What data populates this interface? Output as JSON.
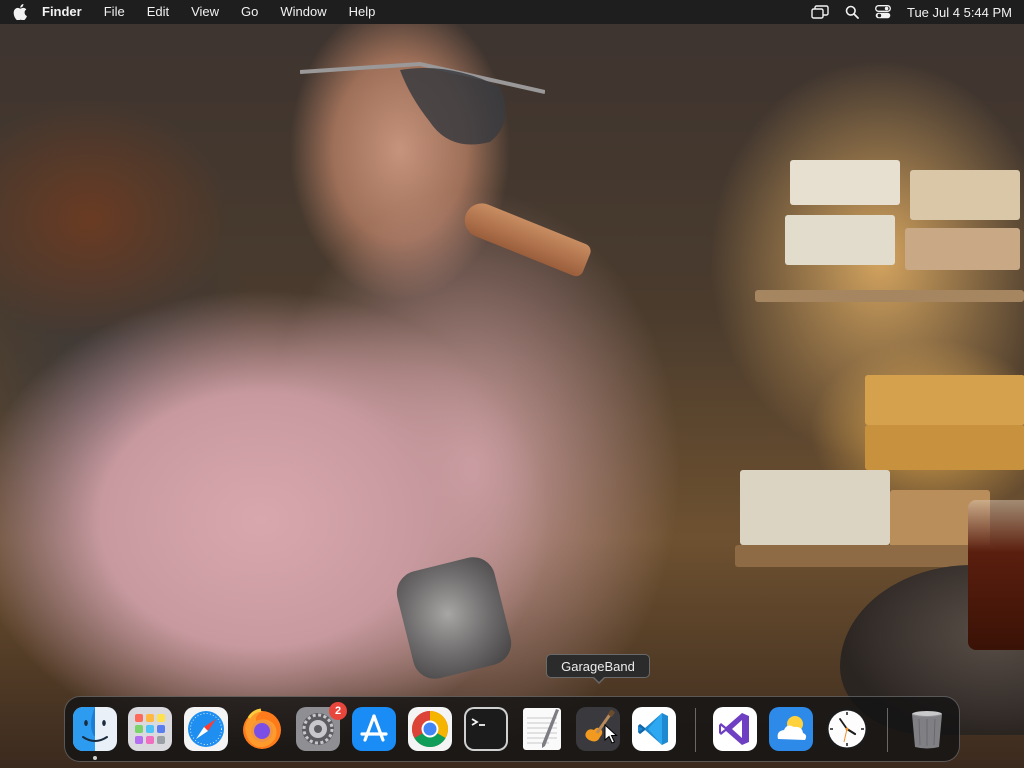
{
  "menubar": {
    "app_name": "Finder",
    "menus": [
      "File",
      "Edit",
      "View",
      "Go",
      "Window",
      "Help"
    ],
    "datetime": "Tue Jul 4  5:44 PM",
    "status_icons": [
      "screen-mirroring-icon",
      "spotlight-search-icon",
      "control-center-icon"
    ]
  },
  "tooltip": {
    "text": "GarageBand"
  },
  "dock": {
    "items": [
      {
        "name": "Finder",
        "icon": "finder-icon",
        "running": true
      },
      {
        "name": "Launchpad",
        "icon": "launchpad-icon"
      },
      {
        "name": "Safari",
        "icon": "safari-icon"
      },
      {
        "name": "Firefox",
        "icon": "firefox-icon"
      },
      {
        "name": "System Settings",
        "icon": "system-settings-icon",
        "badge": "2"
      },
      {
        "name": "App Store",
        "icon": "app-store-icon"
      },
      {
        "name": "Google Chrome",
        "icon": "chrome-icon"
      },
      {
        "name": "Terminal",
        "icon": "terminal-icon"
      },
      {
        "name": "TextEdit",
        "icon": "textedit-icon"
      },
      {
        "name": "GarageBand",
        "icon": "garageband-icon"
      },
      {
        "name": "Visual Studio Code",
        "icon": "vscode-icon"
      },
      {
        "name": "Visual Studio",
        "icon": "visual-studio-icon"
      },
      {
        "name": "Weather",
        "icon": "weather-icon"
      },
      {
        "name": "Clock",
        "icon": "clock-icon"
      },
      {
        "name": "Trash",
        "icon": "trash-icon"
      }
    ]
  },
  "colors": {
    "menubar_bg": "#1e1e1e",
    "dock_bg": "#141414",
    "badge": "#e8453c"
  }
}
